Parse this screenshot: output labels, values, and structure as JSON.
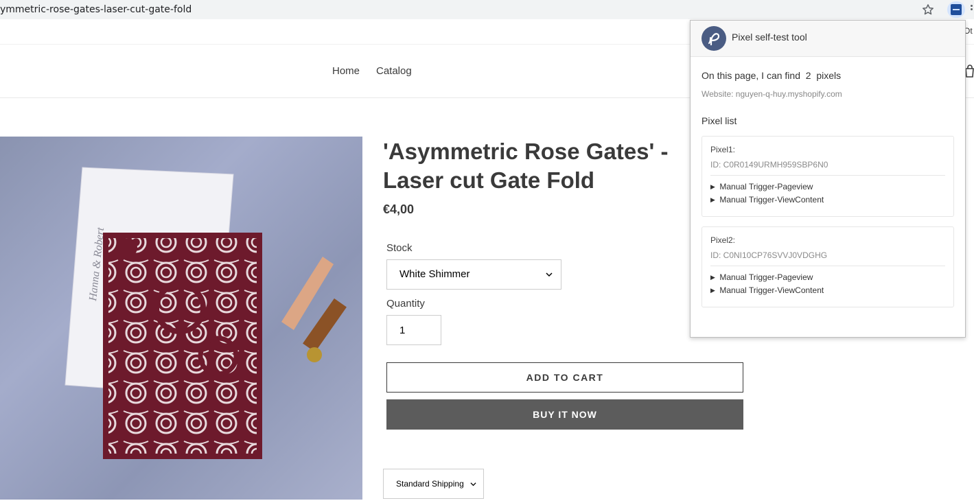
{
  "browser": {
    "url": "ymmetric-rose-gates-laser-cut-gate-fold",
    "star_icon": "star-icon",
    "extension_icon": "pixel-extension-icon",
    "menu_icon": "more-vertical-icon"
  },
  "header": {
    "nav": [
      {
        "label": "Home"
      },
      {
        "label": "Catalog"
      }
    ],
    "right_partial": "Ot",
    "cart_icon": "cart-icon"
  },
  "product": {
    "title": "'Asymmetric Rose Gates' - Laser cut Gate Fold",
    "price": "€4,00",
    "stock_label": "Stock",
    "stock_value": "White Shimmer",
    "quantity_label": "Quantity",
    "quantity_value": "1",
    "add_to_cart": "ADD TO CART",
    "buy_now": "BUY IT NOW",
    "shipping_value": "Standard Shipping",
    "image_icon": "product-photo-rose-gate-invitation"
  },
  "popup": {
    "title": "Pixel self-test tool",
    "found_prefix": "On this page, I can find",
    "found_count": "2",
    "found_suffix": "pixels",
    "website": "Website: nguyen-q-huy.myshopify.com",
    "list_label": "Pixel list",
    "pixels": [
      {
        "name": "Pixel1:",
        "id": "ID: C0R0149URMH959SBP6N0",
        "triggers": [
          "Manual Trigger-Pageview",
          "Manual Trigger-ViewContent"
        ]
      },
      {
        "name": "Pixel2:",
        "id": "ID: C0NI10CP76SVVJ0VDGHG",
        "triggers": [
          "Manual Trigger-Pageview",
          "Manual Trigger-ViewContent"
        ]
      }
    ],
    "colors": {
      "logo": "#4a5c83",
      "header_bg": "#f7f7f7"
    }
  }
}
